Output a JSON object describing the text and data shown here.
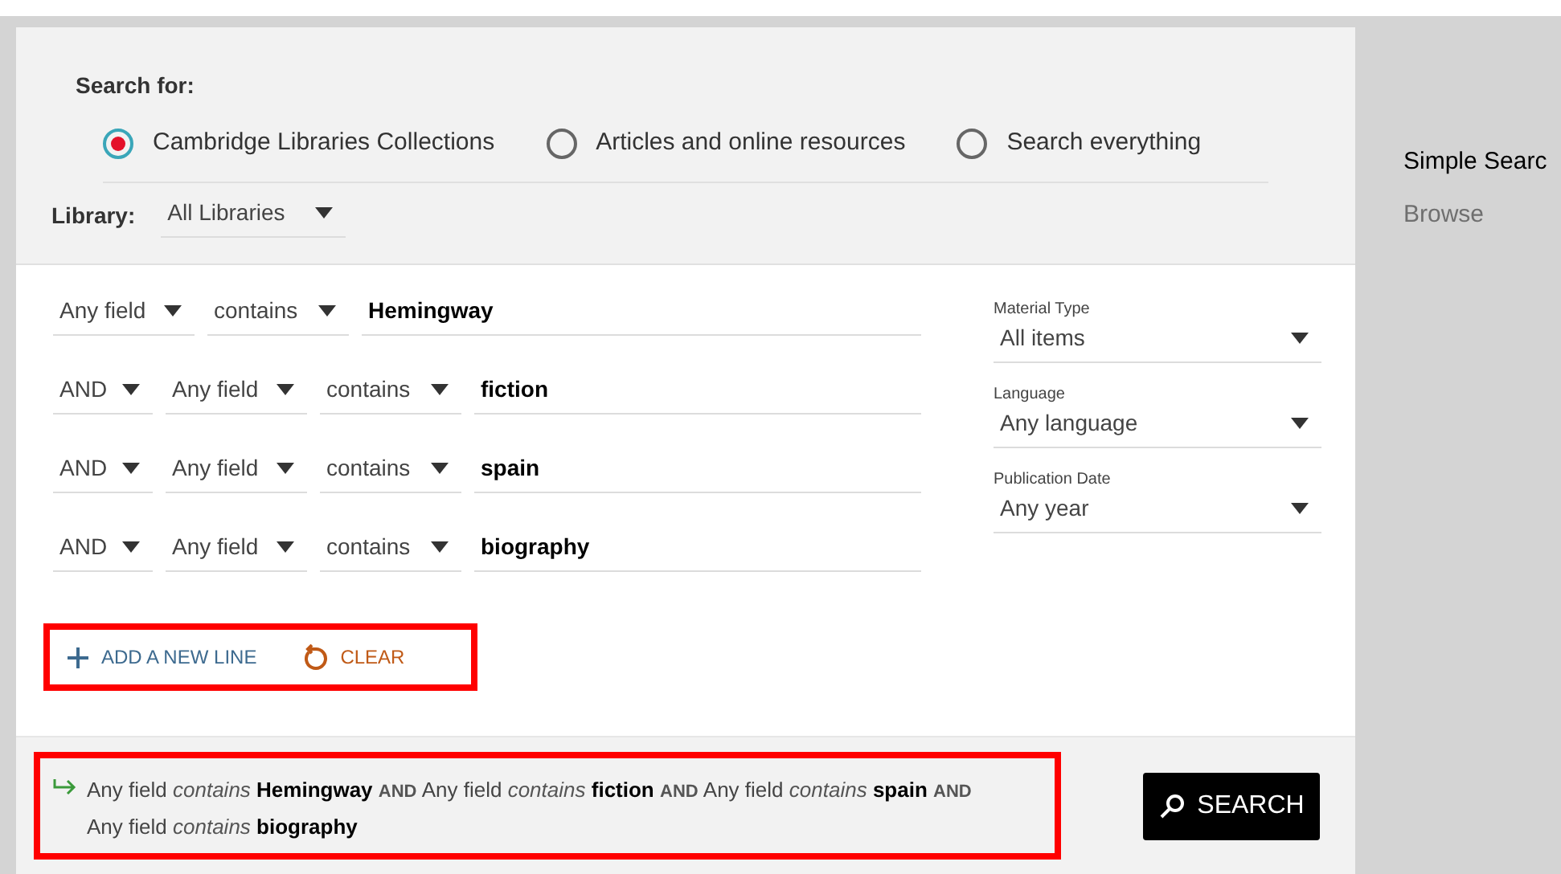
{
  "search_for": {
    "label": "Search for:",
    "options": [
      {
        "label": "Cambridge Libraries Collections",
        "selected": true
      },
      {
        "label": "Articles and online resources",
        "selected": false
      },
      {
        "label": "Search everything",
        "selected": false
      }
    ]
  },
  "library": {
    "label": "Library:",
    "value": "All Libraries"
  },
  "query_lines": [
    {
      "field": "Any field",
      "operator": "contains",
      "value": "Hemingway"
    },
    {
      "boolean": "AND",
      "field": "Any field",
      "operator": "contains",
      "value": "fiction"
    },
    {
      "boolean": "AND",
      "field": "Any field",
      "operator": "contains",
      "value": "spain"
    },
    {
      "boolean": "AND",
      "field": "Any field",
      "operator": "contains",
      "value": "biography"
    }
  ],
  "filters": [
    {
      "label": "Material Type",
      "value": "All items"
    },
    {
      "label": "Language",
      "value": "Any language"
    },
    {
      "label": "Publication Date",
      "value": "Any year"
    }
  ],
  "actions": {
    "add_line": "ADD A NEW LINE",
    "clear": "CLEAR"
  },
  "summary": [
    {
      "kind": "field",
      "text": "Any field"
    },
    {
      "kind": "operator",
      "text": "contains"
    },
    {
      "kind": "term",
      "text": "Hemingway"
    },
    {
      "kind": "boolean",
      "text": "AND"
    },
    {
      "kind": "field",
      "text": "Any field"
    },
    {
      "kind": "operator",
      "text": "contains"
    },
    {
      "kind": "term",
      "text": "fiction"
    },
    {
      "kind": "boolean",
      "text": "AND"
    },
    {
      "kind": "field",
      "text": "Any field"
    },
    {
      "kind": "operator",
      "text": "contains"
    },
    {
      "kind": "term",
      "text": "spain"
    },
    {
      "kind": "boolean",
      "text": "AND"
    },
    {
      "kind": "field",
      "text": "Any field"
    },
    {
      "kind": "operator",
      "text": "contains"
    },
    {
      "kind": "term",
      "text": "biography"
    }
  ],
  "search_button": "SEARCH",
  "side_links": [
    {
      "label": "Simple Searc",
      "selected": true
    },
    {
      "label": "Browse",
      "selected": false
    }
  ]
}
